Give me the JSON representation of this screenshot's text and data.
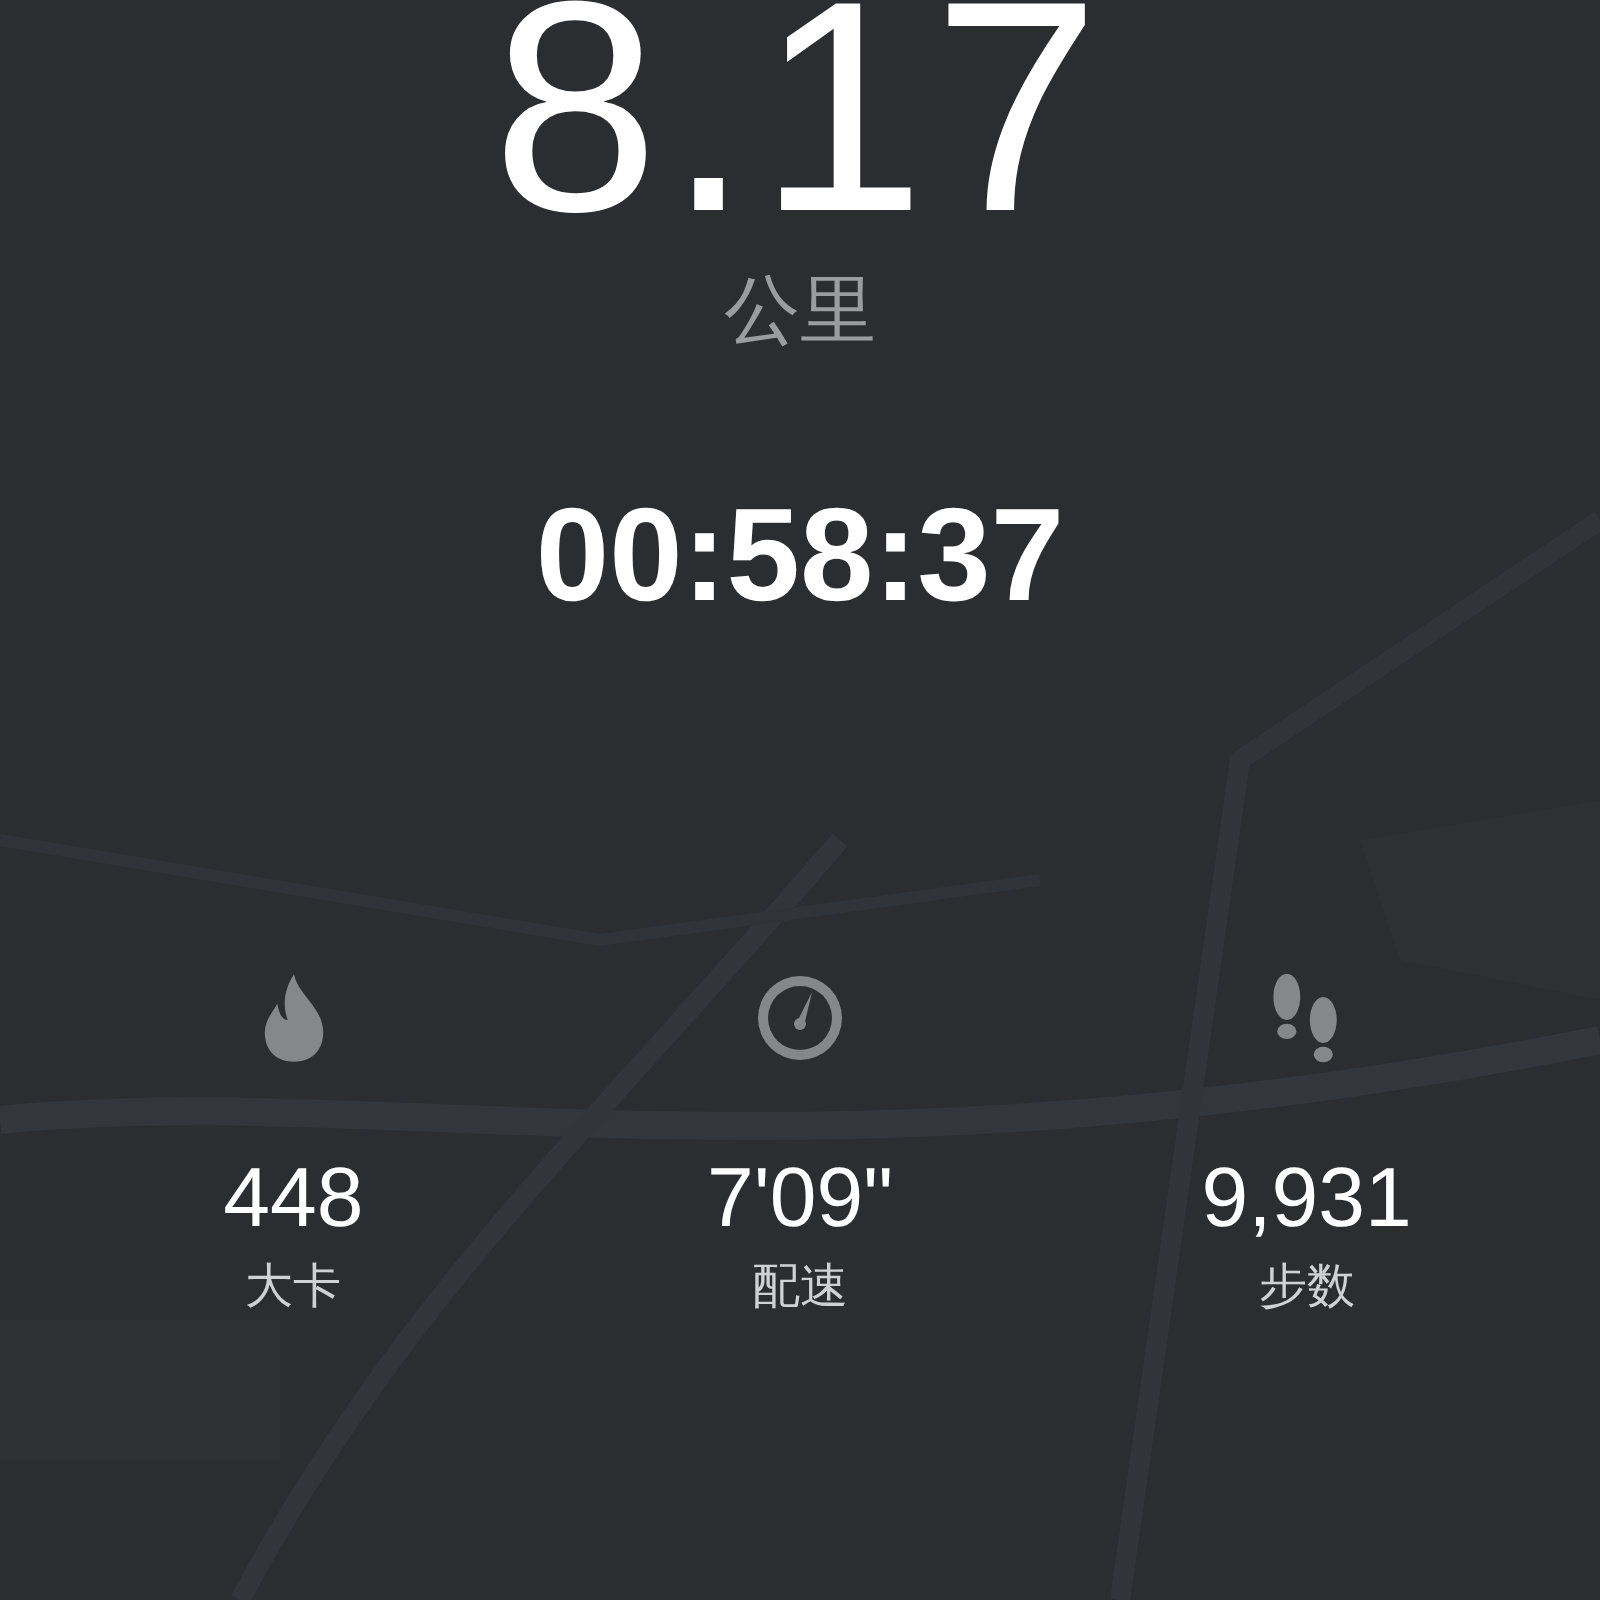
{
  "distance": {
    "value": "8.17",
    "unit": "公里"
  },
  "duration": "00:58:37",
  "stats": [
    {
      "kind": "calories",
      "value": "448",
      "label": "大卡"
    },
    {
      "kind": "pace",
      "value": "7'09\"",
      "label": "配速"
    },
    {
      "kind": "steps",
      "value": "9,931",
      "label": "步数"
    }
  ]
}
